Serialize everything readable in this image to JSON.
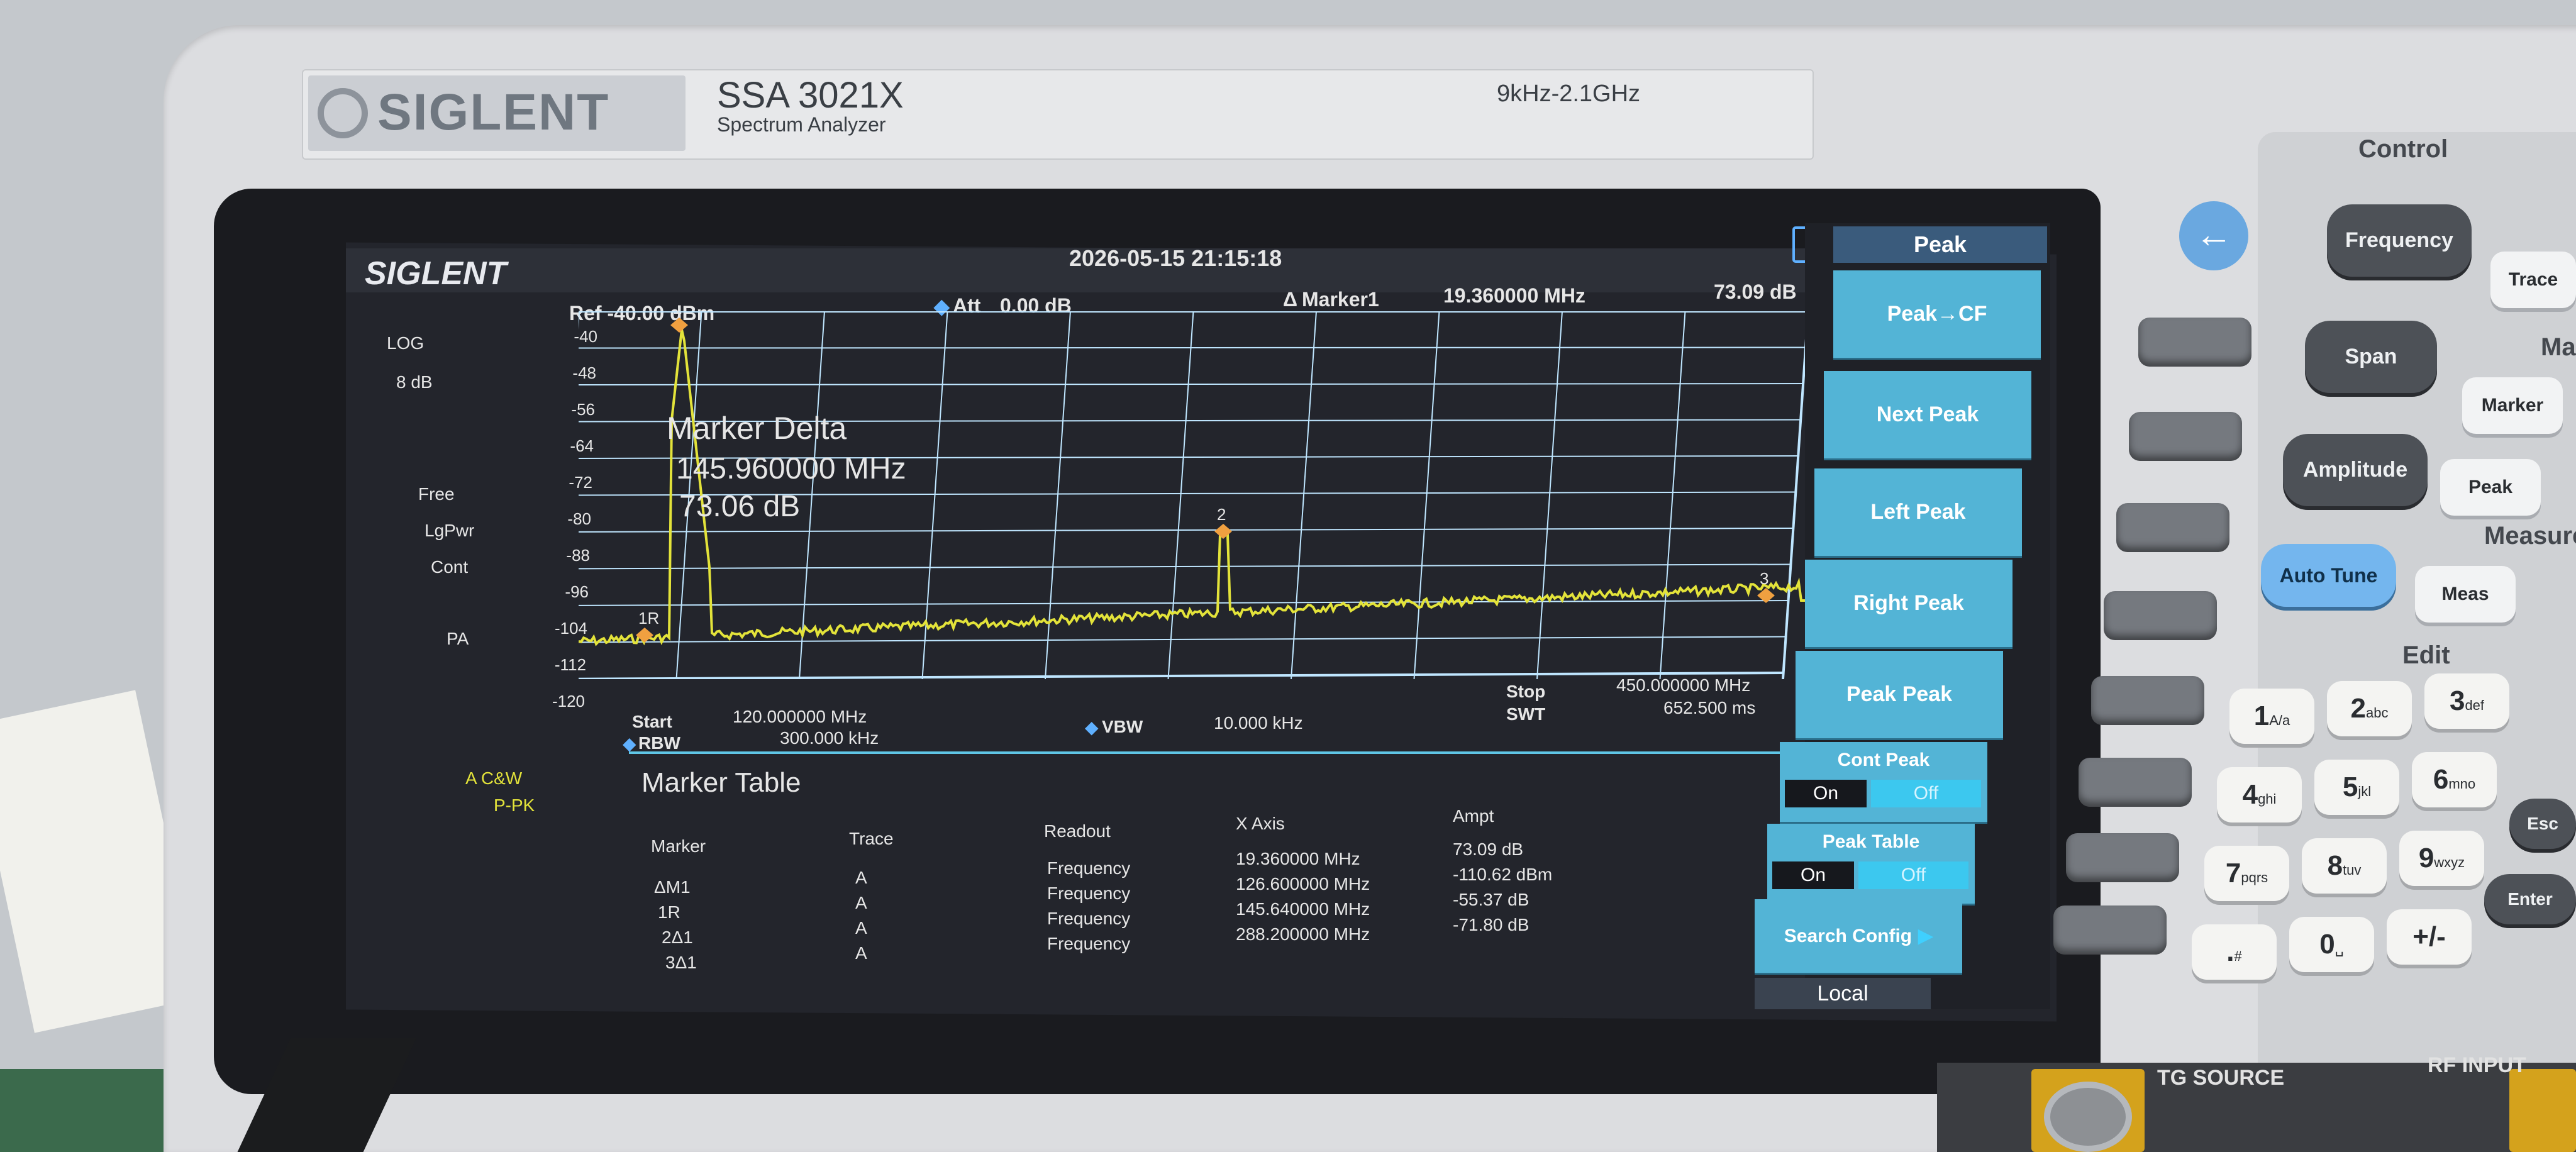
{
  "device": {
    "brand": "SIGLENT",
    "model": "SSA 3021X",
    "model_sub": "Spectrum Analyzer",
    "freq_range": "9kHz-2.1GHz"
  },
  "screen": {
    "logo": "SIGLENT",
    "datetime": "2026-05-15   21:15:18",
    "ref": "Ref  -40.00 dBm",
    "att_label": "Att",
    "att_value": "0.00 dB",
    "marker1_label": "Marker1",
    "marker1_freq": "19.360000 MHz",
    "marker1_ampt": "73.09 dB",
    "scale_type": "LOG",
    "scale_div": "8 dB",
    "left_status": [
      "Free",
      "LgPwr",
      "Cont"
    ],
    "pa": "PA",
    "trace_status_1": "A  C&W",
    "trace_status_2": "P-PK",
    "y_ticks": [
      "-40",
      "-48",
      "-56",
      "-64",
      "-72",
      "-80",
      "-88",
      "-96",
      "-104",
      "-112",
      "-120"
    ],
    "marker_delta": {
      "title": "Marker Delta",
      "freq": "145.960000 MHz",
      "ampt": "73.06 dB"
    },
    "marker_labels": [
      "1",
      "2",
      "3",
      "1R"
    ],
    "start_label": "Start",
    "start_value": "120.000000 MHz",
    "rbw_label": "RBW",
    "rbw_value": "300.000 kHz",
    "vbw_label": "VBW",
    "vbw_value": "10.000 kHz",
    "stop_label": "Stop",
    "stop_value": "450.000000 MHz",
    "swt_label": "SWT",
    "swt_value": "652.500 ms"
  },
  "marker_table": {
    "title": "Marker Table",
    "headers": {
      "marker": "Marker",
      "trace": "Trace",
      "readout": "Readout",
      "x_axis": "X Axis",
      "ampt": "Ampt"
    },
    "rows": [
      {
        "marker": "ΔM1",
        "trace": "A",
        "readout": "Frequency",
        "x": "19.360000 MHz",
        "ampt": "73.09 dB"
      },
      {
        "marker": "1R",
        "trace": "A",
        "readout": "Frequency",
        "x": "126.600000 MHz",
        "ampt": "-110.62 dBm"
      },
      {
        "marker": "2Δ1",
        "trace": "A",
        "readout": "Frequency",
        "x": "145.640000 MHz",
        "ampt": "-55.37 dB"
      },
      {
        "marker": "3Δ1",
        "trace": "A",
        "readout": "Frequency",
        "x": "288.200000 MHz",
        "ampt": "-71.80 dB"
      }
    ]
  },
  "softkeys": {
    "title": "Peak",
    "keys": [
      "Peak→CF",
      "Next Peak",
      "Left Peak",
      "Right Peak",
      "Peak Peak"
    ],
    "cont_peak": {
      "label": "Cont Peak",
      "on": "On",
      "off": "Off"
    },
    "peak_table": {
      "label": "Peak Table",
      "on": "On",
      "off": "Off"
    },
    "search_config": "Search Config",
    "local": "Local"
  },
  "panel": {
    "back_glyph": "←",
    "control": "Control",
    "frequency": "Frequency",
    "span": "Span",
    "amplitude": "Amplitude",
    "auto_tune": "Auto Tune",
    "trace": "Trace",
    "marker_section": "Mark",
    "marker": "Marker",
    "peak": "Peak",
    "measure_section": "Measure",
    "meas": "Meas",
    "edit": "Edit",
    "esc": "Esc",
    "enter": "Enter",
    "keys": [
      {
        "main": "1",
        "sub": "A/a"
      },
      {
        "main": "2",
        "sub": "abc"
      },
      {
        "main": "3",
        "sub": "def"
      },
      {
        "main": "4",
        "sub": "ghi"
      },
      {
        "main": "5",
        "sub": "jkl"
      },
      {
        "main": "6",
        "sub": "mno"
      },
      {
        "main": "7",
        "sub": "pqrs"
      },
      {
        "main": "8",
        "sub": "tuv"
      },
      {
        "main": "9",
        "sub": "wxyz"
      },
      {
        "main": ".",
        "sub": "#"
      },
      {
        "main": "0",
        "sub": "␣"
      },
      {
        "main": "+/-",
        "sub": ""
      }
    ],
    "tg_source": "TG SOURCE",
    "rf_input": "RF INPUT"
  },
  "colors": {
    "trace": "#e3e33a",
    "grid": "#bfe6ff",
    "softkey": "#53b4d6",
    "marker": "#f0a040"
  }
}
